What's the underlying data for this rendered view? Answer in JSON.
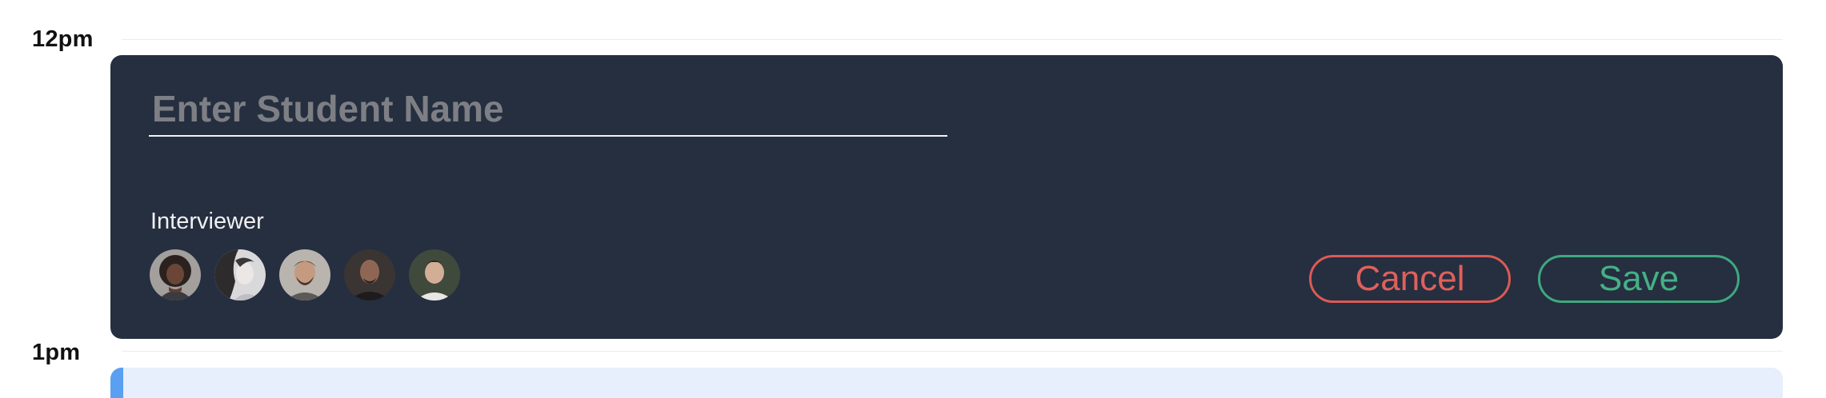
{
  "timeline": {
    "hours": [
      "12pm",
      "1pm"
    ]
  },
  "editor": {
    "name_placeholder": "Enter Student Name",
    "name_value": "",
    "interviewer_label": "Interviewer",
    "avatars": [
      {
        "name": "interviewer-avatar-1"
      },
      {
        "name": "interviewer-avatar-2"
      },
      {
        "name": "interviewer-avatar-3"
      },
      {
        "name": "interviewer-avatar-4"
      },
      {
        "name": "interviewer-avatar-5"
      }
    ],
    "cancel_label": "Cancel",
    "save_label": "Save"
  },
  "colors": {
    "editor_background": "#252f40",
    "cancel": "#dc5a55",
    "save": "#3fa87e",
    "next_event_background": "#e6effb",
    "next_event_accent": "#5b9ff0"
  }
}
